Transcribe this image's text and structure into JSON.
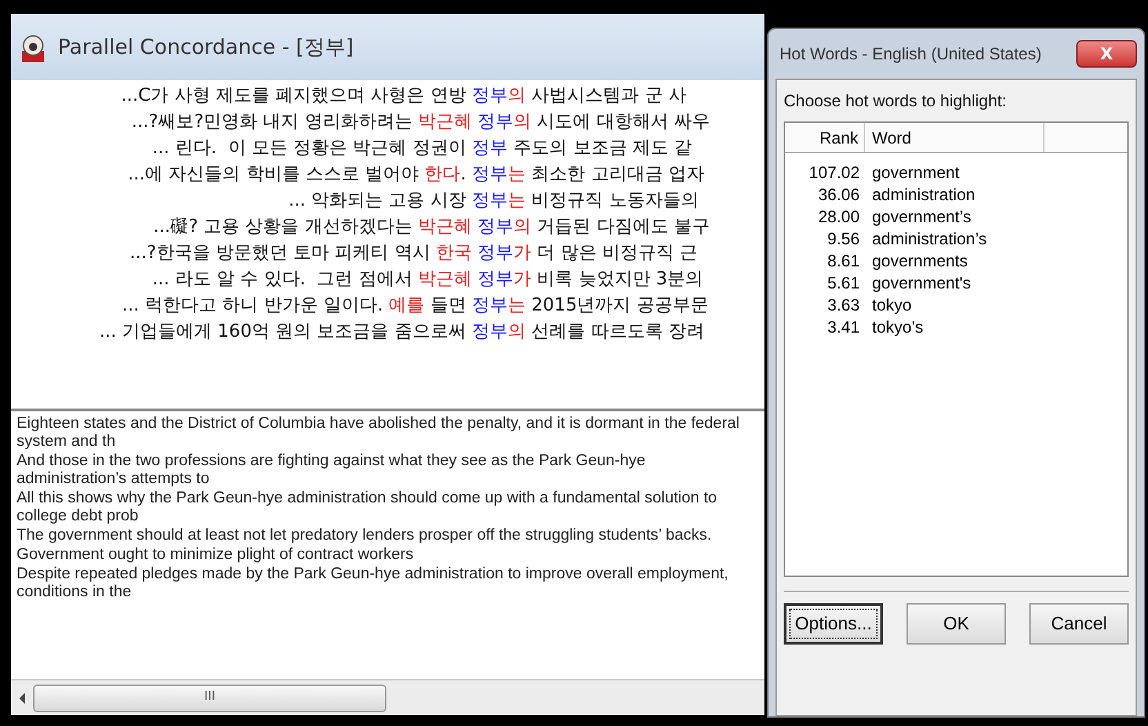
{
  "main_window": {
    "title": "Parallel Concordance - [정부]"
  },
  "concordance": [
    {
      "segments": [
        {
          "kind": "context",
          "text": "...C가 사형 제도를 폐지했으며 사형은 연방 "
        },
        {
          "kind": "node",
          "text": "정부"
        },
        {
          "kind": "highlight",
          "text": "의"
        },
        {
          "kind": "context",
          "text": " 사법시스템과 군 사"
        }
      ]
    },
    {
      "segments": [
        {
          "kind": "context",
          "text": "...?쌔보?민영화 내지 영리화하려는 "
        },
        {
          "kind": "highlight",
          "text": "박근혜"
        },
        {
          "kind": "node",
          "text": "정부"
        },
        {
          "kind": "highlight",
          "text": "의"
        },
        {
          "kind": "context",
          "text": " 시도에 대항해서 싸우"
        }
      ]
    },
    {
      "segments": [
        {
          "kind": "context",
          "text": "... 린다.  이 모든 정황은 박근혜 정권이 "
        },
        {
          "kind": "node",
          "text": "정부"
        },
        {
          "kind": "context",
          "text": " 주도의 보조금 제도 같"
        }
      ]
    },
    {
      "segments": [
        {
          "kind": "context",
          "text": "...에 자신들의 학비를 스스로 벌어야 "
        },
        {
          "kind": "highlight",
          "text": "한다"
        },
        {
          "kind": "context",
          "text": ". "
        },
        {
          "kind": "node",
          "text": "정부"
        },
        {
          "kind": "highlight",
          "text": "는"
        },
        {
          "kind": "context",
          "text": " 최소한 고리대금 업자"
        }
      ]
    },
    {
      "segments": [
        {
          "kind": "context",
          "text": "... 악화되는 고용 시장 "
        },
        {
          "kind": "node",
          "text": "정부"
        },
        {
          "kind": "highlight",
          "text": "는"
        },
        {
          "kind": "context",
          "text": " 비정규직 노동자들의"
        }
      ]
    },
    {
      "segments": [
        {
          "kind": "context",
          "text": "...礙? 고용 상황을 개선하겠다는 "
        },
        {
          "kind": "highlight",
          "text": "박근혜"
        },
        {
          "kind": "node",
          "text": "정부"
        },
        {
          "kind": "highlight",
          "text": "의"
        },
        {
          "kind": "context",
          "text": " 거듭된 다짐에도 불구"
        }
      ]
    },
    {
      "segments": [
        {
          "kind": "context",
          "text": "...?한국을 방문했던 토마 피케티 역시 "
        },
        {
          "kind": "highlight",
          "text": "한국"
        },
        {
          "kind": "node",
          "text": "정부"
        },
        {
          "kind": "highlight",
          "text": "가"
        },
        {
          "kind": "context",
          "text": " 더 많은 비정규직 근"
        }
      ]
    },
    {
      "segments": [
        {
          "kind": "context",
          "text": "... 라도 알 수 있다.  그런 점에서 "
        },
        {
          "kind": "highlight",
          "text": "박근혜"
        },
        {
          "kind": "node",
          "text": "정부"
        },
        {
          "kind": "highlight",
          "text": "가"
        },
        {
          "kind": "context",
          "text": " 비록 늦었지만 3분의"
        }
      ]
    },
    {
      "segments": [
        {
          "kind": "context",
          "text": "... 럭한다고 하니 반가운 일이다. "
        },
        {
          "kind": "highlight",
          "text": "예를"
        },
        {
          "kind": "context",
          "text": " 들면 "
        },
        {
          "kind": "node",
          "text": "정부"
        },
        {
          "kind": "highlight",
          "text": "는"
        },
        {
          "kind": "context",
          "text": " 2015년까지 공공부문"
        }
      ]
    },
    {
      "segments": [
        {
          "kind": "context",
          "text": "... 기업들에게 160억 원의 보조금을 줌으로써 "
        },
        {
          "kind": "node",
          "text": "정부"
        },
        {
          "kind": "highlight",
          "text": "의"
        },
        {
          "kind": "context",
          "text": " 선례를 따르도록 장려"
        }
      ]
    }
  ],
  "translations": [
    "Eighteen states and the District of Columbia have abolished the penalty, and it is dormant in the federal system and th",
    "And those in the two professions are fighting against what they see as the Park Geun-hye administration’s attempts to",
    "All this shows why the Park Geun-hye administration should come up with a fundamental solution to college debt prob",
    "The government should at least not let predatory lenders prosper off the struggling students’ backs.",
    "Government ought to minimize plight of contract workers",
    "Despite repeated pledges made by the Park Geun-hye administration to improve overall employment, conditions in the"
  ],
  "dialog": {
    "title": "Hot Words - English (United States)",
    "close": "X",
    "prompt": "Choose hot words to highlight:",
    "columns": [
      "Rank",
      "Word"
    ],
    "rows": [
      {
        "rank": "107.02",
        "word": "government"
      },
      {
        "rank": "36.06",
        "word": "administration"
      },
      {
        "rank": "28.00",
        "word": "government’s"
      },
      {
        "rank": "9.56",
        "word": "administration’s"
      },
      {
        "rank": "8.61",
        "word": "governments"
      },
      {
        "rank": "5.61",
        "word": "government's"
      },
      {
        "rank": "3.63",
        "word": "tokyo"
      },
      {
        "rank": "3.41",
        "word": "tokyo’s"
      }
    ],
    "buttons": [
      {
        "label": "Options...",
        "focused": true
      },
      {
        "label": "OK",
        "focused": false
      },
      {
        "label": "Cancel",
        "focused": false
      }
    ]
  },
  "scrollbar": {
    "grip": "III"
  }
}
